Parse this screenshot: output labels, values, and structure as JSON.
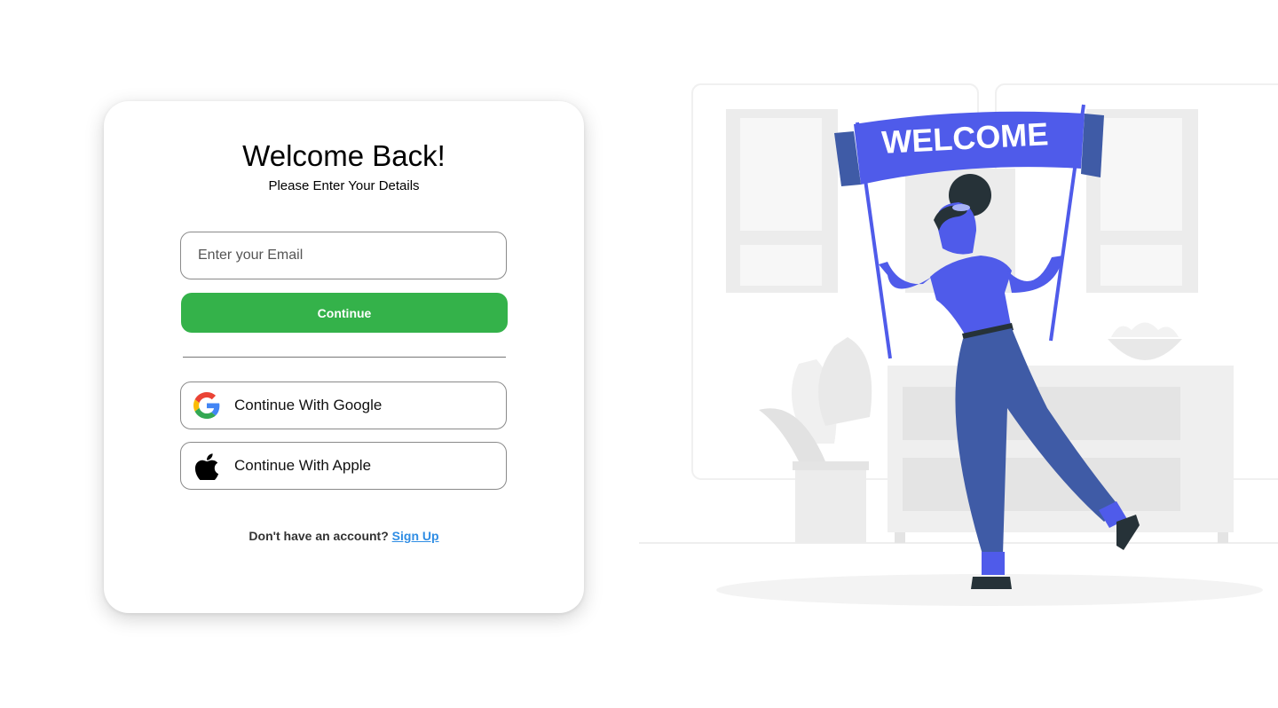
{
  "login": {
    "title": "Welcome Back!",
    "subtitle": "Please Enter Your Details",
    "email": {
      "value": "",
      "placeholder": "Enter your Email"
    },
    "continue_label": "Continue",
    "google_label": "Continue With Google",
    "apple_label": "Continue With Apple",
    "signup_prompt": "Don't have an account?",
    "signup_link": "Sign Up"
  },
  "illustration": {
    "banner_text": "WELCOME"
  },
  "colors": {
    "primary_button": "#34b24a",
    "link": "#2f8de4",
    "illustration_accent": "#4f5bea",
    "illustration_pants": "#3f5ba6"
  },
  "icons": {
    "google": "google-logo-icon",
    "apple": "apple-logo-icon"
  }
}
